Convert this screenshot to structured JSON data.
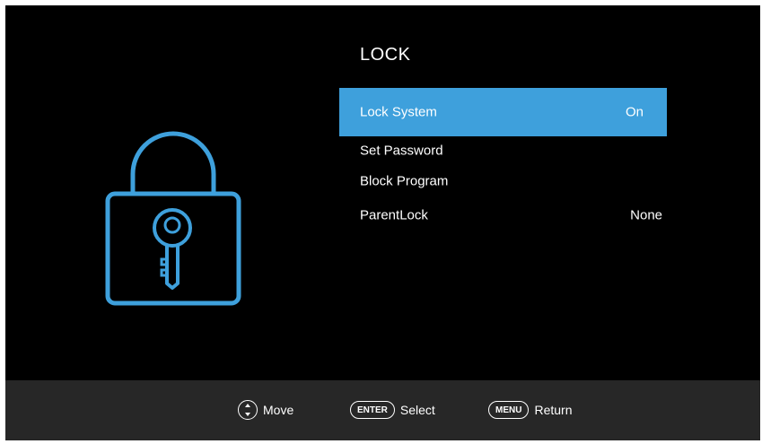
{
  "menu": {
    "title": "LOCK",
    "items": [
      {
        "label": "Lock  System",
        "value": "On"
      },
      {
        "label": "Set  Password",
        "value": ""
      },
      {
        "label": "Block  Program",
        "value": ""
      },
      {
        "label": "ParentLock",
        "value": "None"
      }
    ],
    "selected_index": 0
  },
  "footer": {
    "move": {
      "icon": "up-down-nav-icon",
      "label": "Move"
    },
    "select": {
      "key": "ENTER",
      "label": "Select"
    },
    "return": {
      "key": "MENU",
      "label": "Return"
    }
  },
  "colors": {
    "background": "#000000",
    "highlight": "#3ea0dc",
    "footer": "#272727",
    "lock_icon": "#3ea0dc"
  },
  "decor": {
    "icon": "padlock-key-icon"
  }
}
